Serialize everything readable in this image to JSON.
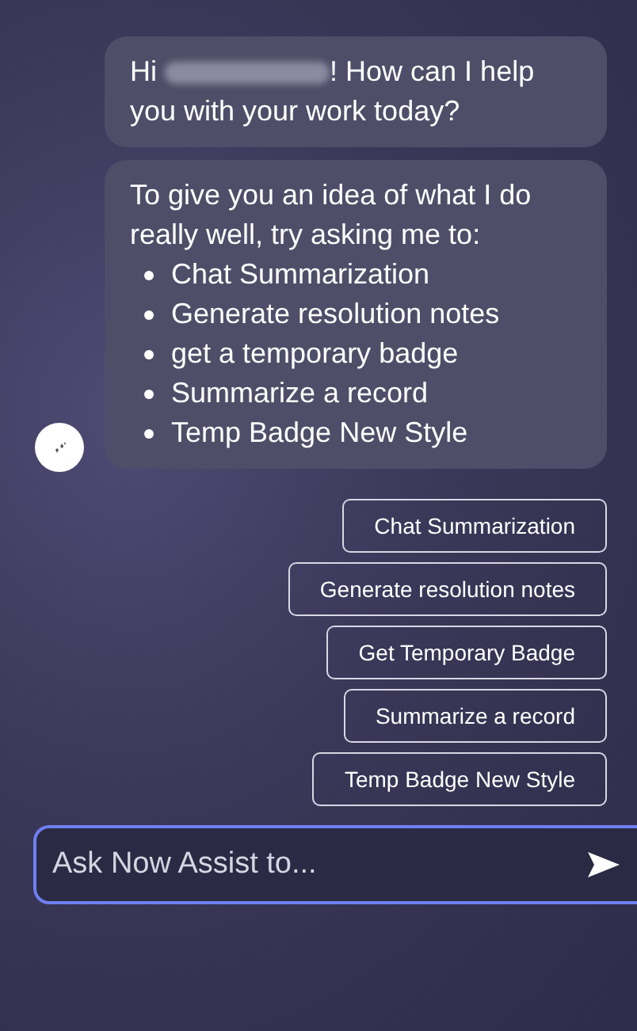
{
  "messages": [
    {
      "kind": "greeting",
      "before": "Hi",
      "after": "! How can I help you with your work today?"
    },
    {
      "kind": "list",
      "text": "To give you an idea of what I do really well, try asking me to:",
      "items": [
        "Chat Summarization",
        "Generate resolution notes",
        "get a temporary badge",
        "Summarize a record",
        "Temp Badge New Style"
      ]
    }
  ],
  "suggestions": [
    "Chat Summarization",
    "Generate resolution notes",
    "Get Temporary Badge",
    "Summarize a record",
    "Temp Badge New Style"
  ],
  "input": {
    "placeholder": "Ask Now Assist to..."
  }
}
